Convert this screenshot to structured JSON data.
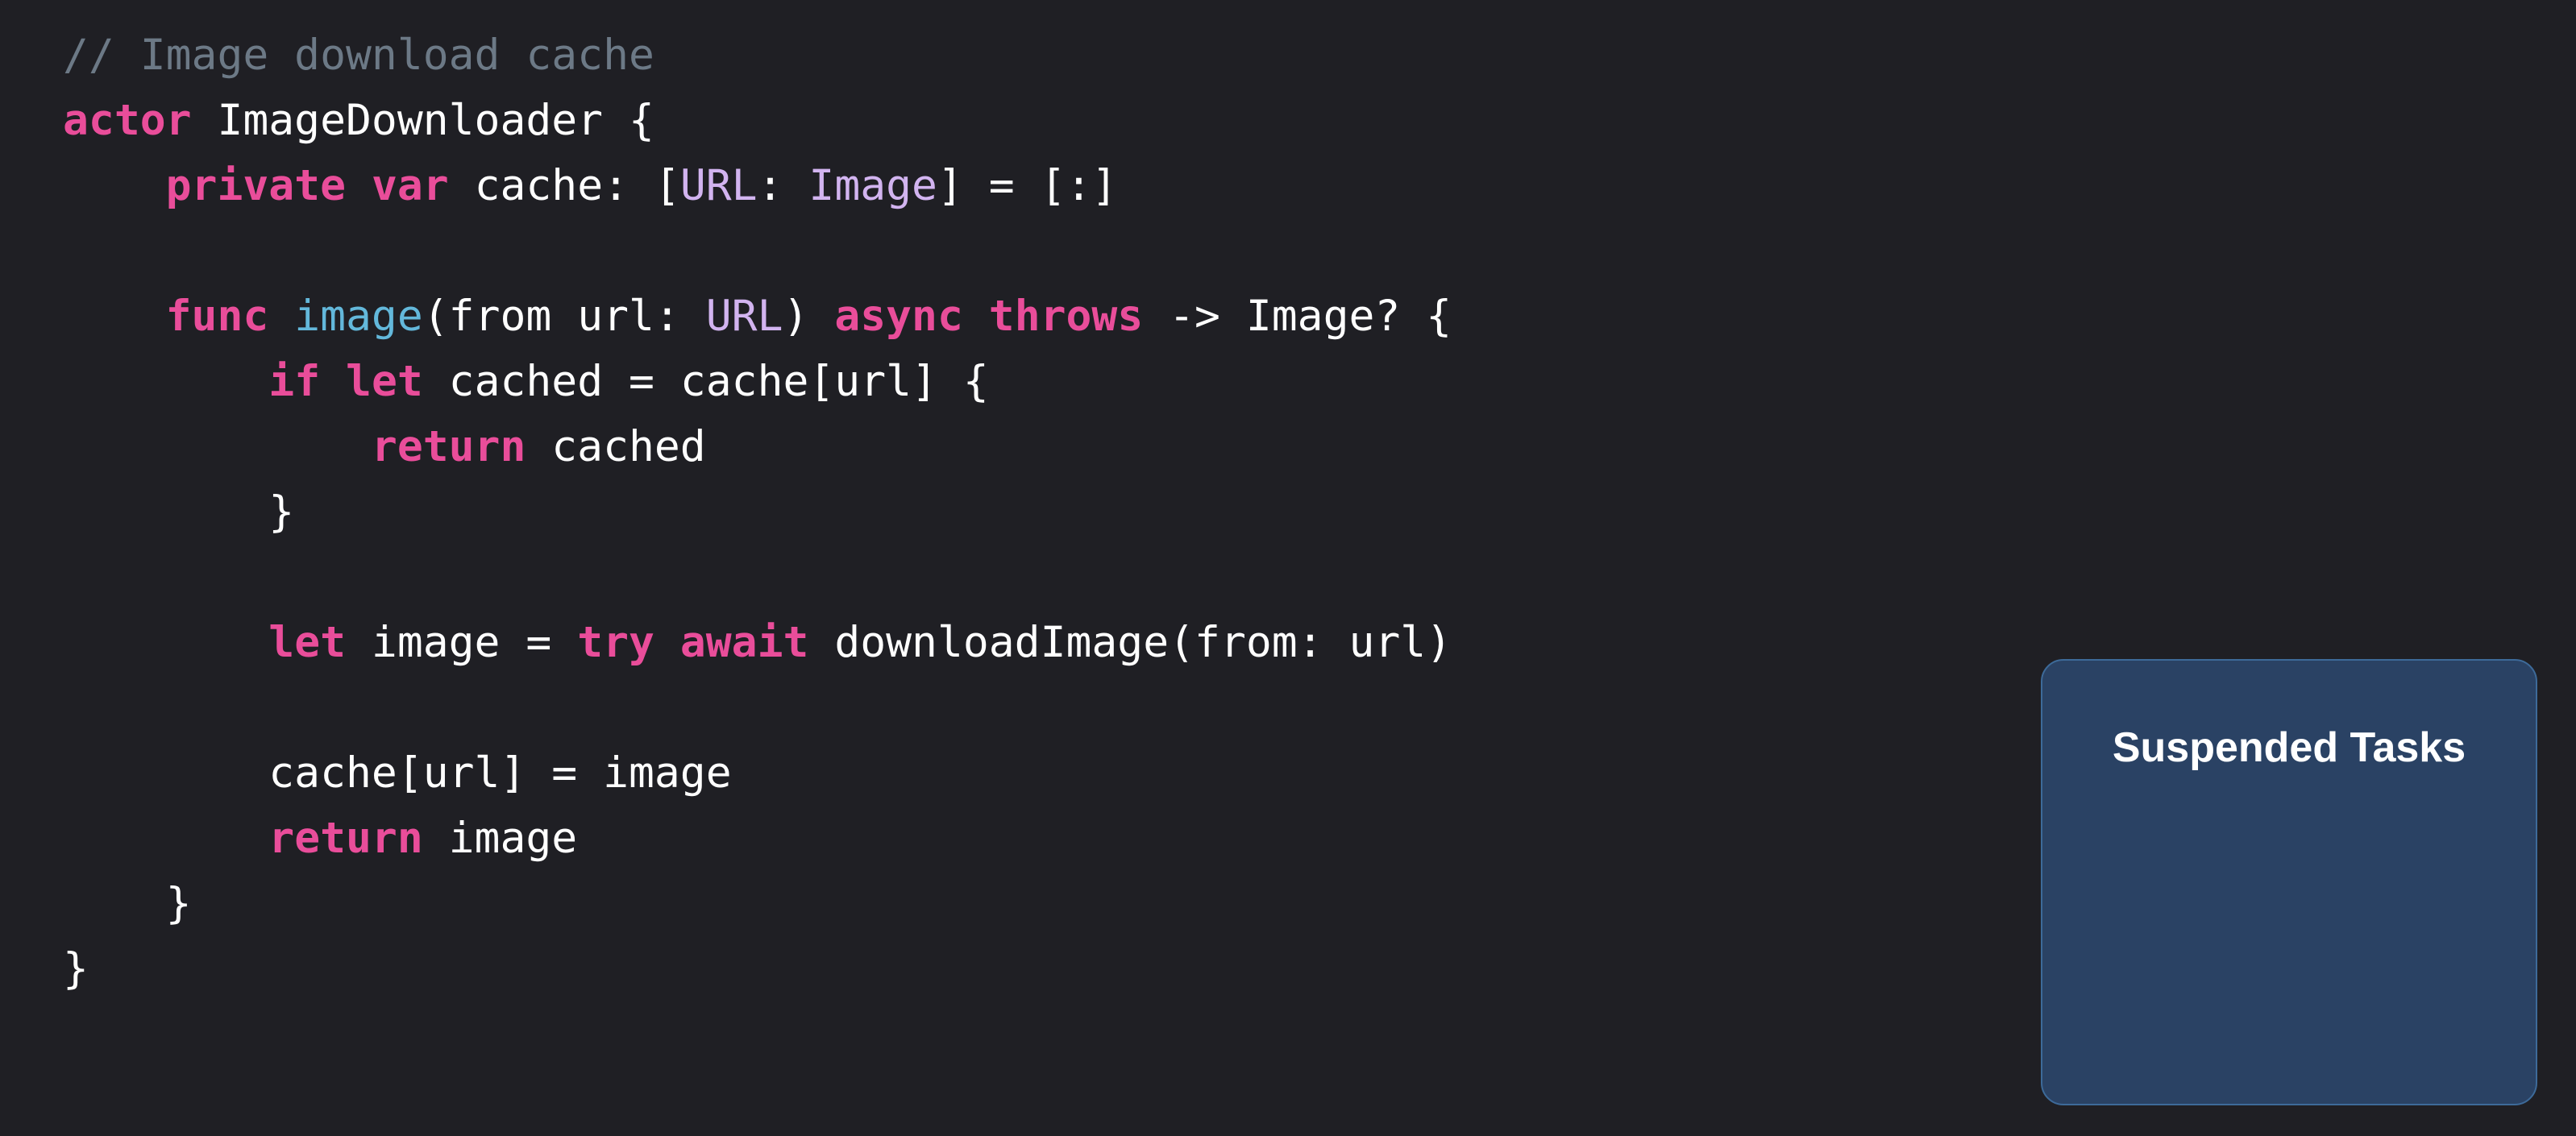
{
  "colors": {
    "background": "#1f1f24",
    "keyword": "#e94d9a",
    "type": "#d2b4f0",
    "function": "#63b8db",
    "comment": "#6c7986",
    "text": "#ffffff",
    "panel_fill": "#2a4264",
    "panel_border": "#3d6a99"
  },
  "code_lines": [
    [
      {
        "t": "// Image download cache",
        "k": "cm"
      }
    ],
    [
      {
        "t": "actor",
        "k": "kw"
      },
      {
        "t": " ImageDownloader {",
        "k": "tx"
      }
    ],
    [
      {
        "t": "    ",
        "k": "tx"
      },
      {
        "t": "private",
        "k": "kw"
      },
      {
        "t": " ",
        "k": "tx"
      },
      {
        "t": "var",
        "k": "kw"
      },
      {
        "t": " cache: [",
        "k": "tx"
      },
      {
        "t": "URL",
        "k": "ty"
      },
      {
        "t": ": ",
        "k": "tx"
      },
      {
        "t": "Image",
        "k": "ty"
      },
      {
        "t": "] = [:]",
        "k": "tx"
      }
    ],
    [],
    [
      {
        "t": "    ",
        "k": "tx"
      },
      {
        "t": "func",
        "k": "kw"
      },
      {
        "t": " ",
        "k": "tx"
      },
      {
        "t": "image",
        "k": "fn"
      },
      {
        "t": "(from url: ",
        "k": "tx"
      },
      {
        "t": "URL",
        "k": "ty"
      },
      {
        "t": ") ",
        "k": "tx"
      },
      {
        "t": "async",
        "k": "kw"
      },
      {
        "t": " ",
        "k": "tx"
      },
      {
        "t": "throws",
        "k": "kw"
      },
      {
        "t": " -> Image? {",
        "k": "tx"
      }
    ],
    [
      {
        "t": "        ",
        "k": "tx"
      },
      {
        "t": "if",
        "k": "kw"
      },
      {
        "t": " ",
        "k": "tx"
      },
      {
        "t": "let",
        "k": "kw"
      },
      {
        "t": " cached = cache[url] {",
        "k": "tx"
      }
    ],
    [
      {
        "t": "            ",
        "k": "tx"
      },
      {
        "t": "return",
        "k": "kw"
      },
      {
        "t": " cached",
        "k": "tx"
      }
    ],
    [
      {
        "t": "        }",
        "k": "tx"
      }
    ],
    [],
    [
      {
        "t": "        ",
        "k": "tx"
      },
      {
        "t": "let",
        "k": "kw"
      },
      {
        "t": " image = ",
        "k": "tx"
      },
      {
        "t": "try",
        "k": "kw"
      },
      {
        "t": " ",
        "k": "tx"
      },
      {
        "t": "await",
        "k": "kw"
      },
      {
        "t": " downloadImage(from: url)",
        "k": "tx"
      }
    ],
    [],
    [
      {
        "t": "        cache[url] = image",
        "k": "tx"
      }
    ],
    [
      {
        "t": "        ",
        "k": "tx"
      },
      {
        "t": "return",
        "k": "kw"
      },
      {
        "t": " image",
        "k": "tx"
      }
    ],
    [
      {
        "t": "    }",
        "k": "tx"
      }
    ],
    [
      {
        "t": "}",
        "k": "tx"
      }
    ]
  ],
  "panel": {
    "title": "Suspended Tasks"
  }
}
